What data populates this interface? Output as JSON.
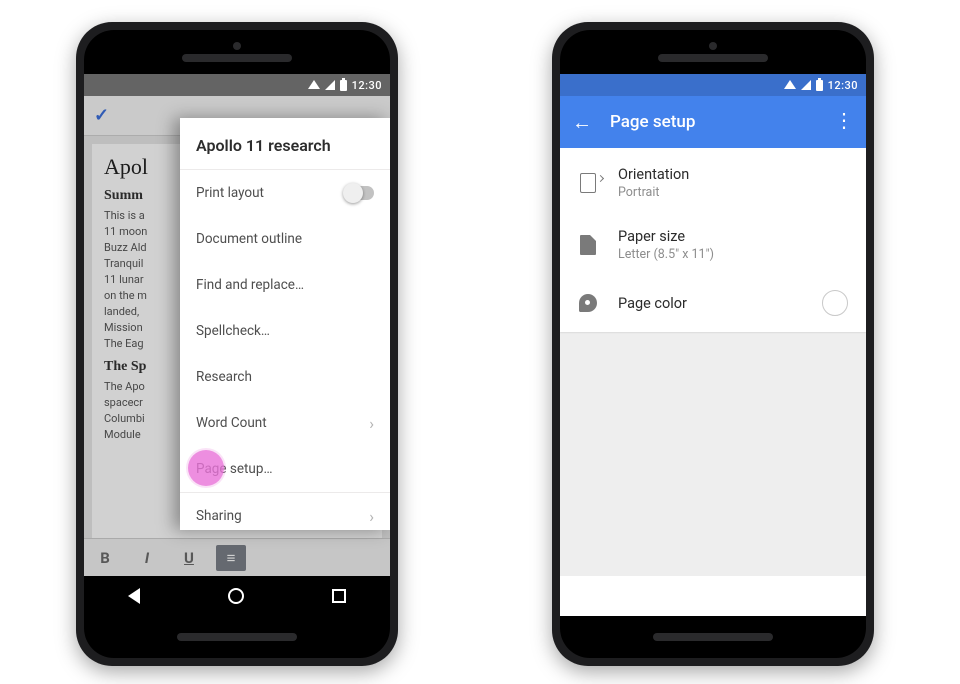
{
  "status": {
    "time": "12:30"
  },
  "left": {
    "doc": {
      "title": "Apollo 11 research",
      "heading": "Apol",
      "section1_title": "Summ",
      "section1_body": "This is a\n11 moon\nBuzz Ald\nTranquil\n11 lunar\non the m\nlanded,\nMission\nThe Eag",
      "section2_title": "The Sp",
      "section2_body": "The Apo\nspacecr\nColumbi\nModule"
    },
    "menu": {
      "title": "Apollo 11 research",
      "items": [
        {
          "id": "print-layout",
          "label": "Print layout",
          "kind": "toggle",
          "checked": false
        },
        {
          "id": "document-outline",
          "label": "Document outline",
          "kind": "plain"
        },
        {
          "id": "find-replace",
          "label": "Find and replace…",
          "kind": "plain"
        },
        {
          "id": "spellcheck",
          "label": "Spellcheck…",
          "kind": "plain"
        },
        {
          "id": "research",
          "label": "Research",
          "kind": "plain"
        },
        {
          "id": "word-count",
          "label": "Word Count",
          "kind": "chevron"
        },
        {
          "id": "page-setup",
          "label": "Page setup…",
          "kind": "plain",
          "highlighted": true
        },
        {
          "id": "sharing",
          "label": "Sharing",
          "kind": "chevron",
          "divider_before": true
        }
      ]
    },
    "fmt": {
      "bold": "B",
      "italic": "I",
      "underline": "U"
    }
  },
  "right": {
    "appbar": {
      "title": "Page setup"
    },
    "rows": [
      {
        "id": "orientation",
        "icon": "orientation-icon",
        "label": "Orientation",
        "sub": "Portrait"
      },
      {
        "id": "paper-size",
        "icon": "page-icon",
        "label": "Paper size",
        "sub": "Letter (8.5\" x 11\")"
      },
      {
        "id": "page-color",
        "icon": "palette-icon",
        "label": "Page color",
        "swatch": "#ffffff"
      }
    ]
  }
}
